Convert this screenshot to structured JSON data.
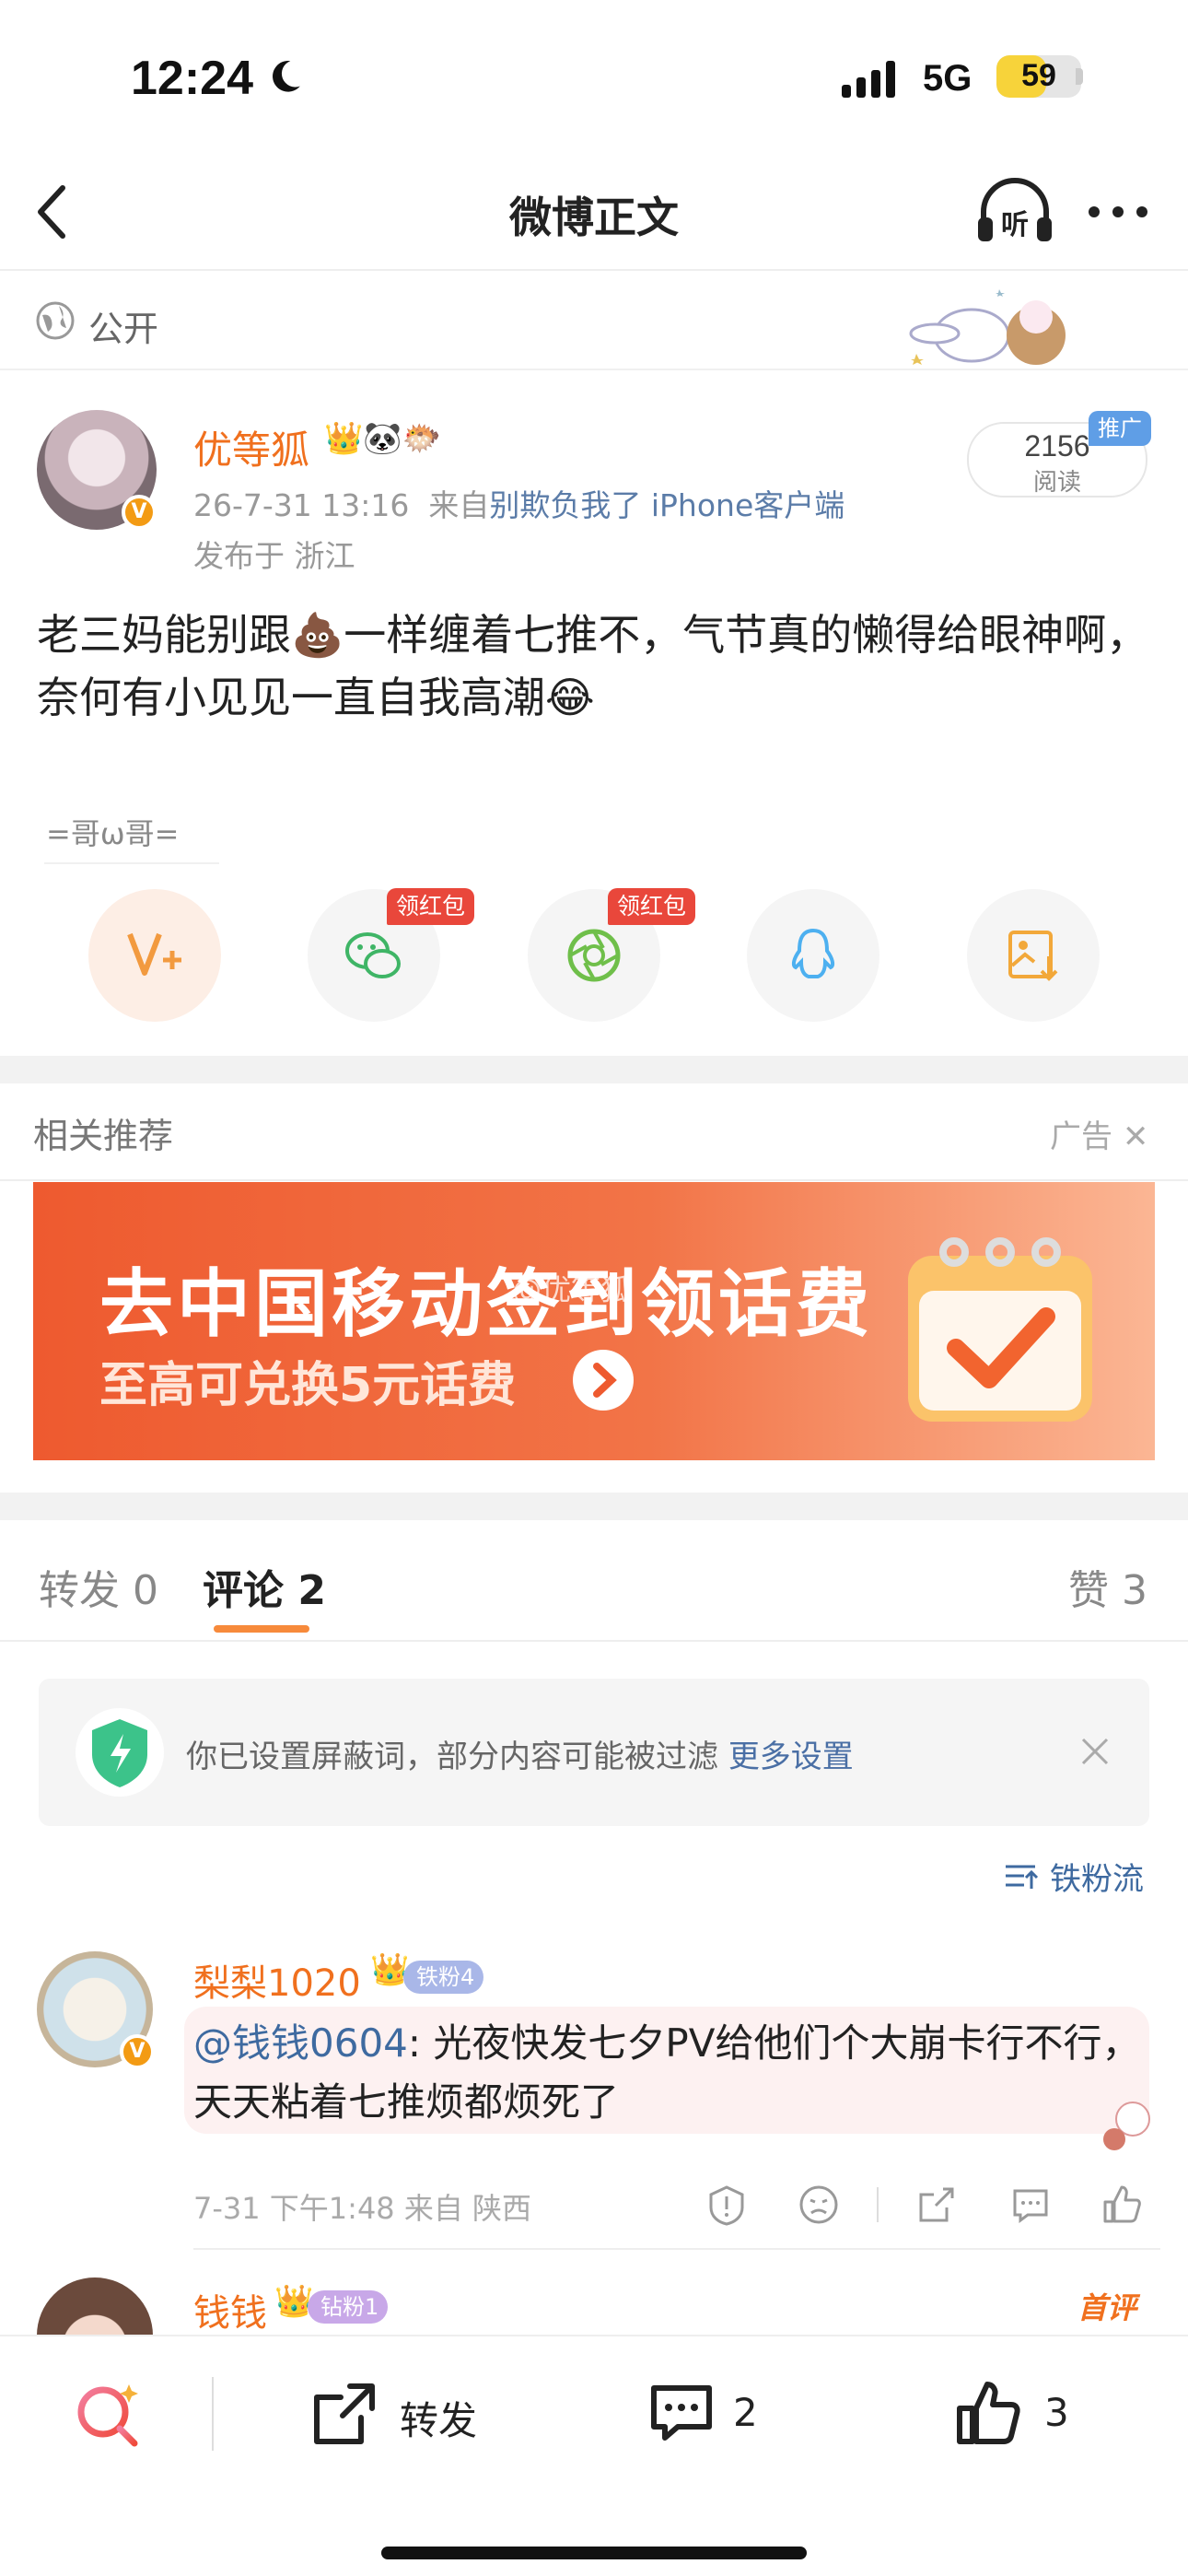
{
  "status_bar": {
    "time": "12:24",
    "network": "5G",
    "battery": "59",
    "battery_level": 0.59
  },
  "nav": {
    "title": "微博正文",
    "listen_label": "听"
  },
  "visibility": {
    "label": "公开"
  },
  "post": {
    "username": "优等狐",
    "datetime": "26-7-31 13:16",
    "from_prefix": "来自",
    "source": "别欺负我了 iPhone客户端",
    "location": "发布于 浙江",
    "reads": "2156",
    "reads_label": "阅读",
    "promo_label": "推广",
    "text": "老三妈能别跟💩一样缠着七推不，气节真的懒得给眼神啊，奈何有小见见一直自我高潮😂",
    "emoticon_tag": "=哥ω哥=",
    "redpack_label": "领红包"
  },
  "related": {
    "title": "相关推荐",
    "ad_label": "广告",
    "banner_title": "去中国移动签到领话费",
    "banner_sub": "至高可兑换5元话费",
    "banner_watermark": "@优等狐"
  },
  "tabs": [
    {
      "label": "转发 0"
    },
    {
      "label": "评论 2"
    },
    {
      "label": "赞 3"
    }
  ],
  "notice": {
    "text": "你已设置屏蔽词，部分内容可能被过滤",
    "link": "更多设置"
  },
  "sort": {
    "label": "铁粉流"
  },
  "comments": [
    {
      "username": "梨梨1020",
      "fan_badge": "铁粉4",
      "mention": "@钱钱0604",
      "text": ": 光夜快发七夕PV给他们个大崩卡行不行，天天粘着七推烦都烦死了",
      "meta": "7-31 下午1:48 来自 陕西"
    },
    {
      "username": "钱钱",
      "fan_badge": "钻粉1",
      "first_label": "首评"
    }
  ],
  "bottom_bar": {
    "repost_label": "转发",
    "comment_count": "2",
    "like_count": "3"
  },
  "colors": {
    "accent": "#f0701e",
    "link": "#3e6aa0",
    "tab_underline": "#f78a3b"
  }
}
